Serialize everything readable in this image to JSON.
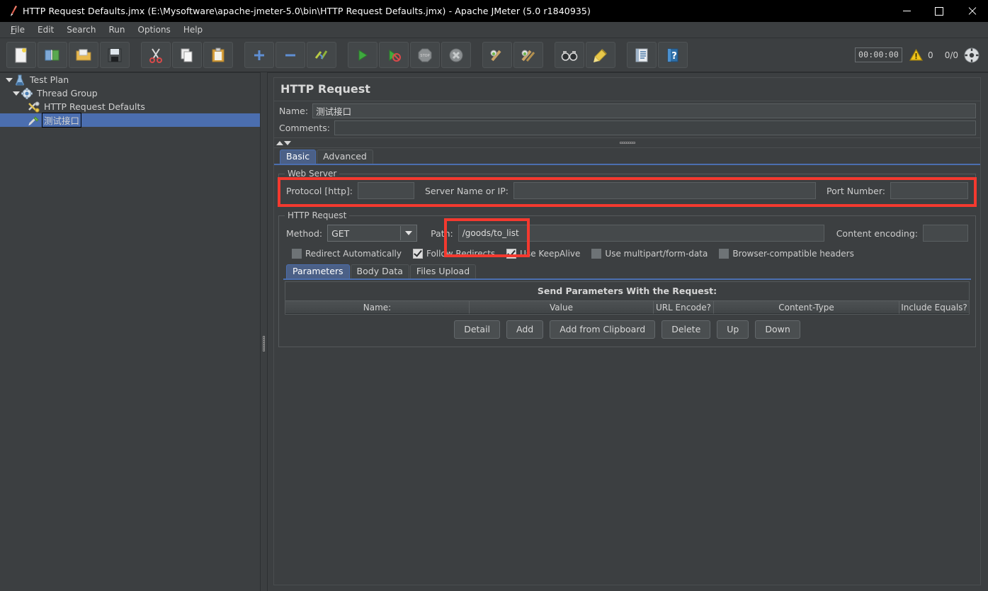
{
  "window": {
    "title": "HTTP Request Defaults.jmx (E:\\Mysoftware\\apache-jmeter-5.0\\bin\\HTTP Request Defaults.jmx) - Apache JMeter (5.0 r1840935)",
    "app_icon": "jmeter-feather-icon",
    "minimize_label": "Minimize",
    "maximize_label": "Maximize",
    "close_label": "Close"
  },
  "menubar": {
    "items": [
      {
        "label": "File",
        "mnemonic": "F"
      },
      {
        "label": "Edit",
        "mnemonic": "E"
      },
      {
        "label": "Search",
        "mnemonic": "S"
      },
      {
        "label": "Run",
        "mnemonic": "R"
      },
      {
        "label": "Options",
        "mnemonic": "O"
      },
      {
        "label": "Help",
        "mnemonic": "H"
      }
    ]
  },
  "toolbar": {
    "buttons": [
      {
        "name": "new-icon",
        "tooltip": "New"
      },
      {
        "name": "templates-icon",
        "tooltip": "Templates"
      },
      {
        "name": "open-icon",
        "tooltip": "Open"
      },
      {
        "name": "save-icon",
        "tooltip": "Save Test Plan"
      },
      {
        "name": "cut-icon",
        "tooltip": "Cut"
      },
      {
        "name": "copy-icon",
        "tooltip": "Copy"
      },
      {
        "name": "paste-icon",
        "tooltip": "Paste"
      },
      {
        "name": "expand-all-icon",
        "tooltip": "Expand All"
      },
      {
        "name": "collapse-all-icon",
        "tooltip": "Collapse All"
      },
      {
        "name": "toggle-icon",
        "tooltip": "Toggle"
      },
      {
        "name": "start-icon",
        "tooltip": "Start"
      },
      {
        "name": "start-no-pauses-icon",
        "tooltip": "Start no pauses"
      },
      {
        "name": "stop-icon",
        "tooltip": "Stop"
      },
      {
        "name": "shutdown-icon",
        "tooltip": "Shutdown"
      },
      {
        "name": "clear-icon",
        "tooltip": "Clear"
      },
      {
        "name": "clear-all-icon",
        "tooltip": "Clear All"
      },
      {
        "name": "search-icon",
        "tooltip": "Search"
      },
      {
        "name": "search-reset-icon",
        "tooltip": "Reset Search"
      },
      {
        "name": "function-helper-icon",
        "tooltip": "Function Helper Dialog"
      },
      {
        "name": "help-icon",
        "tooltip": "Help"
      }
    ],
    "status": {
      "timer": "00:00:00",
      "warning_icon": "warning-triangle-icon",
      "warning_count": "0",
      "threads_running": "0/0",
      "remote_icon": "remote-engines-icon"
    }
  },
  "tree": {
    "nodes": [
      {
        "label": "Test Plan",
        "icon": "test-plan-icon",
        "depth": 0,
        "expanded": true,
        "selected": false
      },
      {
        "label": "Thread Group",
        "icon": "thread-group-icon",
        "depth": 1,
        "expanded": true,
        "selected": false
      },
      {
        "label": "HTTP Request Defaults",
        "icon": "http-defaults-icon",
        "depth": 2,
        "expanded": null,
        "selected": false
      },
      {
        "label": "测试接口",
        "icon": "http-request-icon",
        "depth": 2,
        "expanded": null,
        "selected": true
      }
    ]
  },
  "panel": {
    "title": "HTTP Request",
    "name_label": "Name:",
    "name_value": "测试接口",
    "comments_label": "Comments:",
    "comments_value": "",
    "tabs": [
      {
        "label": "Basic",
        "active": true
      },
      {
        "label": "Advanced",
        "active": false
      }
    ],
    "web_server": {
      "legend": "Web Server",
      "protocol_label": "Protocol [http]:",
      "protocol_value": "",
      "server_label": "Server Name or IP:",
      "server_value": "",
      "port_label": "Port Number:",
      "port_value": "",
      "highlighted": true,
      "highlight_color": "#f4392f"
    },
    "http_request": {
      "legend": "HTTP Request",
      "method_label": "Method:",
      "method_value": "GET",
      "path_label": "Path:",
      "path_value": "/goods/to_list",
      "path_highlighted": true,
      "highlight_color": "#f4392f",
      "content_encoding_label": "Content encoding:",
      "content_encoding_value": "",
      "checkboxes": [
        {
          "label": "Redirect Automatically",
          "checked": false
        },
        {
          "label": "Follow Redirects",
          "checked": true
        },
        {
          "label": "Use KeepAlive",
          "checked": true
        },
        {
          "label": "Use multipart/form-data",
          "checked": false
        },
        {
          "label": "Browser-compatible headers",
          "checked": false
        }
      ],
      "sub_tabs": [
        {
          "label": "Parameters",
          "active": true
        },
        {
          "label": "Body Data",
          "active": false
        },
        {
          "label": "Files Upload",
          "active": false
        }
      ],
      "params_table": {
        "title": "Send Parameters With the Request:",
        "columns": [
          "Name:",
          "Value",
          "URL Encode?",
          "Content-Type",
          "Include Equals?"
        ],
        "rows": []
      },
      "buttons": [
        "Detail",
        "Add",
        "Add from Clipboard",
        "Delete",
        "Up",
        "Down"
      ]
    }
  }
}
